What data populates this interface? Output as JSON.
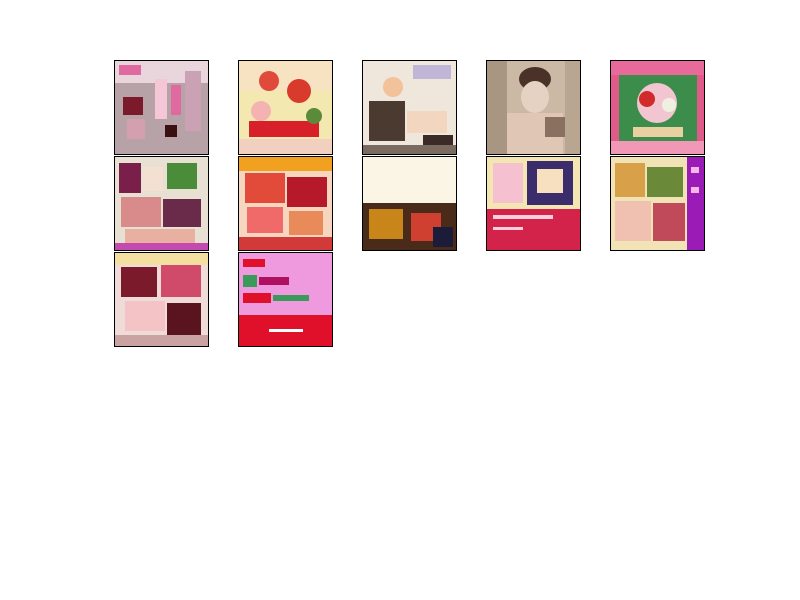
{
  "grid": {
    "thumbnails": [
      {
        "id": "t1",
        "palette": [
          "#b7a2a8",
          "#e06aa0",
          "#7a1a2a",
          "#f4c6d6"
        ],
        "subject": "pink-magazine-cover"
      },
      {
        "id": "t2",
        "palette": [
          "#f3e9b0",
          "#d83a2c",
          "#f5b2b2",
          "#5a8a3a"
        ],
        "subject": "red-rose-illustration"
      },
      {
        "id": "t3",
        "palette": [
          "#efe6dc",
          "#4a3a30",
          "#f2c29a",
          "#c1b6d8"
        ],
        "subject": "couple-illustration"
      },
      {
        "id": "t4",
        "palette": [
          "#cbb9a5",
          "#4b3228",
          "#e6d2c2",
          "#8a7060"
        ],
        "subject": "portrait-photo"
      },
      {
        "id": "t5",
        "palette": [
          "#e05a8a",
          "#3c8c4c",
          "#f1c6d1",
          "#d12a2a"
        ],
        "subject": "green-floral-cover"
      },
      {
        "id": "t6",
        "palette": [
          "#e9e0d4",
          "#7a1e4a",
          "#4a8c3a",
          "#d98a8a"
        ],
        "subject": "anime-group-cover"
      },
      {
        "id": "t7",
        "palette": [
          "#e24a3a",
          "#f2a020",
          "#f7d6c0",
          "#b61a2a"
        ],
        "subject": "red-orange-cover"
      },
      {
        "id": "t8",
        "palette": [
          "#fbf5e6",
          "#4a2b1a",
          "#c8861a",
          "#1b1b3a"
        ],
        "subject": "two-panel-cover"
      },
      {
        "id": "t9",
        "palette": [
          "#f4e6b2",
          "#d4234a",
          "#3b2c6b",
          "#f5c0d0"
        ],
        "subject": "pink-banner-cover"
      },
      {
        "id": "t10",
        "palette": [
          "#f1e3b6",
          "#9b1bb6",
          "#d9a04a",
          "#6a8a3a"
        ],
        "subject": "purple-side-cover"
      },
      {
        "id": "t11",
        "palette": [
          "#efdcd8",
          "#7a1a2a",
          "#d04a6a",
          "#f3c3c6"
        ],
        "subject": "rose-portrait-cover"
      },
      {
        "id": "t12",
        "palette": [
          "#ef9ade",
          "#e0102a",
          "#3a9a5a",
          "#ffffff"
        ],
        "subject": "pink-text-cover"
      }
    ]
  }
}
